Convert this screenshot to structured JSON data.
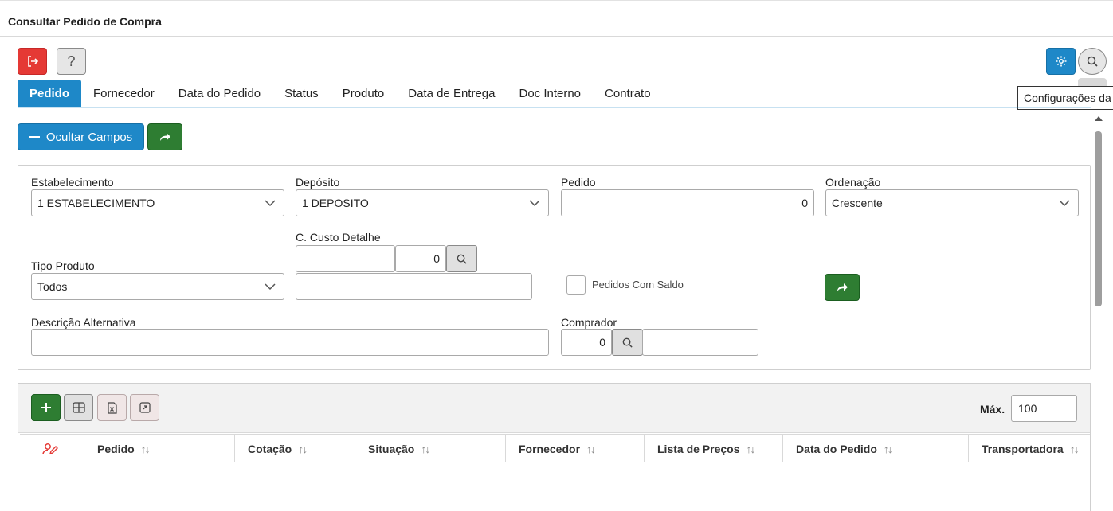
{
  "window": {
    "title": "Consultar Pedido de Compra"
  },
  "toolbar": {
    "exit_icon": "exit-icon",
    "help_label": "?",
    "settings_icon": "gear-icon",
    "search_icon": "search-icon"
  },
  "tooltip": {
    "text": "Configurações da"
  },
  "tabs": [
    {
      "label": "Pedido",
      "active": true
    },
    {
      "label": "Fornecedor"
    },
    {
      "label": "Data do Pedido"
    },
    {
      "label": "Status"
    },
    {
      "label": "Produto"
    },
    {
      "label": "Data de Entrega"
    },
    {
      "label": "Doc Interno"
    },
    {
      "label": "Contrato"
    }
  ],
  "actions": {
    "hide_fields_label": "Ocultar Campos"
  },
  "form": {
    "estabelecimento": {
      "label": "Estabelecimento",
      "value": "1 ESTABELECIMENTO"
    },
    "deposito": {
      "label": "Depósito",
      "value": "1 DEPOSITO"
    },
    "pedido": {
      "label": "Pedido",
      "value": "0"
    },
    "ordenacao": {
      "label": "Ordenação",
      "value": "Crescente"
    },
    "custo_detalhe": {
      "label": "C. Custo Detalhe",
      "code": "",
      "number": "0",
      "description": ""
    },
    "tipo_produto": {
      "label": "Tipo Produto",
      "value": "Todos"
    },
    "pedidos_com_saldo": {
      "label": "Pedidos Com Saldo",
      "checked": false
    },
    "descricao_alternativa": {
      "label": "Descrição Alternativa",
      "value": ""
    },
    "comprador": {
      "label": "Comprador",
      "value": "0",
      "name": ""
    }
  },
  "grid": {
    "max_label": "Máx.",
    "max_value": "100",
    "columns": [
      "Pedido",
      "Cotação",
      "Situação",
      "Fornecedor",
      "Lista de Preços",
      "Data do Pedido",
      "Transportadora"
    ],
    "sort_glyph": "↑↓"
  },
  "colors": {
    "primary": "#1e88c8",
    "danger": "#e53935",
    "success": "#2e7d32"
  }
}
